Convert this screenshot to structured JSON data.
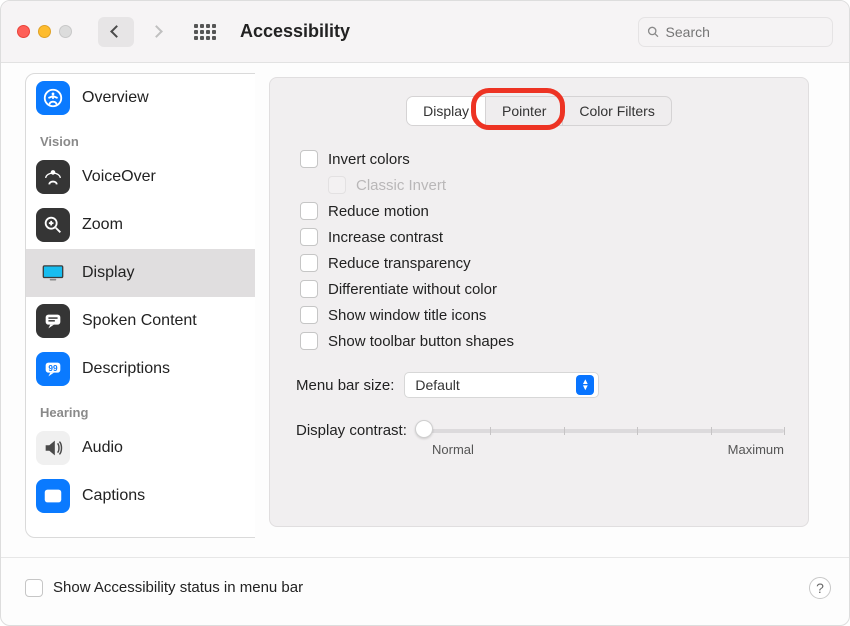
{
  "header": {
    "title": "Accessibility",
    "search_placeholder": "Search"
  },
  "sidebar": {
    "sections": [
      {
        "heading": null,
        "items": [
          {
            "label": "Overview",
            "icon": "overview",
            "selected": false
          }
        ]
      },
      {
        "heading": "Vision",
        "items": [
          {
            "label": "VoiceOver",
            "icon": "voiceover",
            "selected": false
          },
          {
            "label": "Zoom",
            "icon": "zoom",
            "selected": false
          },
          {
            "label": "Display",
            "icon": "display",
            "selected": true
          },
          {
            "label": "Spoken Content",
            "icon": "spoken",
            "selected": false
          },
          {
            "label": "Descriptions",
            "icon": "descriptions",
            "selected": false
          }
        ]
      },
      {
        "heading": "Hearing",
        "items": [
          {
            "label": "Audio",
            "icon": "audio",
            "selected": false
          },
          {
            "label": "Captions",
            "icon": "captions",
            "selected": false
          }
        ]
      }
    ]
  },
  "main": {
    "tabs": [
      {
        "label": "Display",
        "active": true
      },
      {
        "label": "Pointer",
        "active": false,
        "highlighted": true
      },
      {
        "label": "Color Filters",
        "active": false
      }
    ],
    "options": [
      {
        "label": "Invert colors",
        "sub": false
      },
      {
        "label": "Classic Invert",
        "sub": true
      },
      {
        "label": "Reduce motion",
        "sub": false
      },
      {
        "label": "Increase contrast",
        "sub": false
      },
      {
        "label": "Reduce transparency",
        "sub": false
      },
      {
        "label": "Differentiate without color",
        "sub": false
      },
      {
        "label": "Show window title icons",
        "sub": false
      },
      {
        "label": "Show toolbar button shapes",
        "sub": false
      }
    ],
    "menu_bar_size": {
      "label": "Menu bar size:",
      "value": "Default"
    },
    "contrast": {
      "label": "Display contrast:",
      "min_label": "Normal",
      "max_label": "Maximum"
    }
  },
  "footer": {
    "checkbox_label": "Show Accessibility status in menu bar"
  }
}
